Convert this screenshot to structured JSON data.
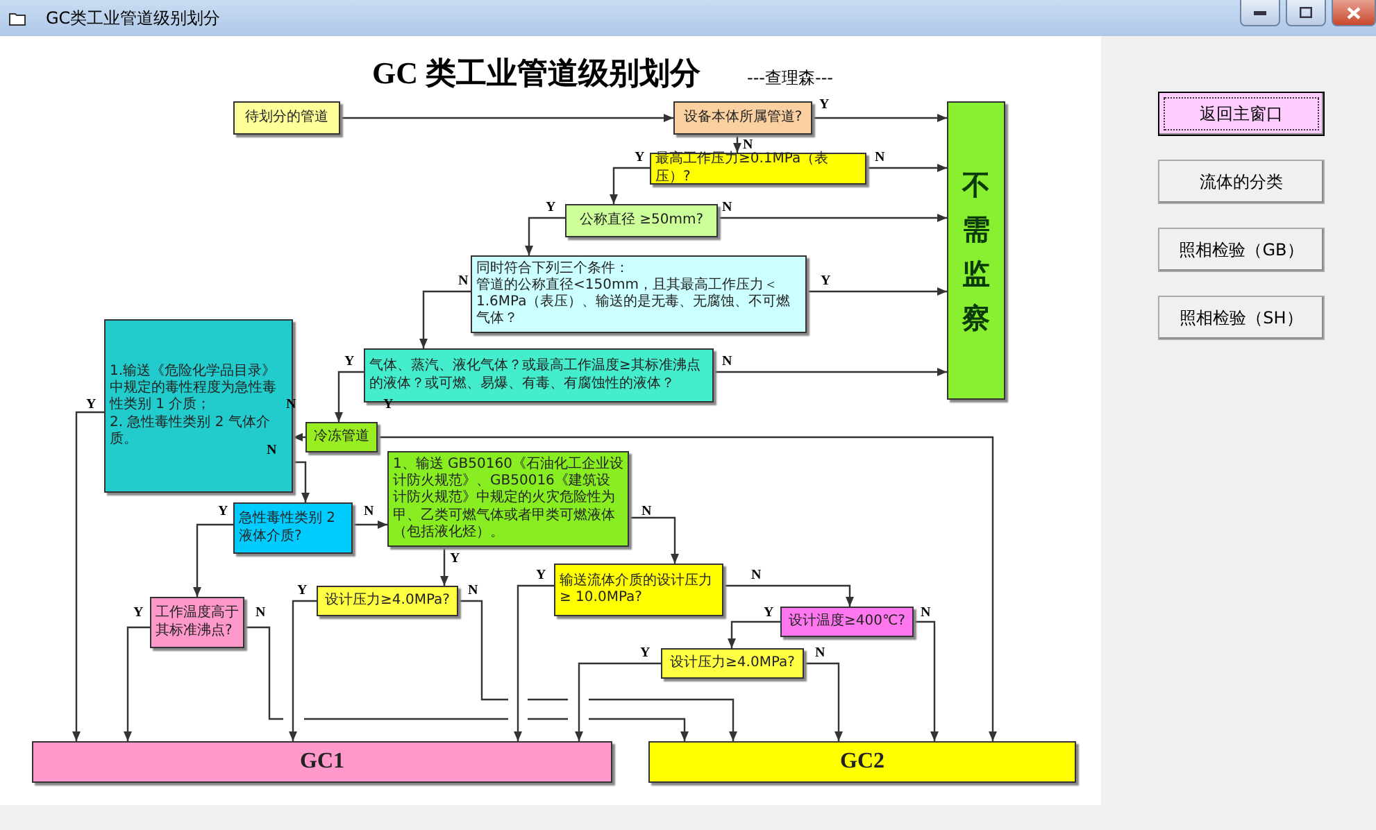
{
  "window": {
    "title": "GC类工业管道级别划分"
  },
  "chart_title": "GC 类工业管道级别划分",
  "author": "---查理森---",
  "nodes": [
    {
      "kind": "box",
      "lines": [
        "待划分的管道"
      ],
      "color": "#ffff99"
    },
    {
      "kind": "box",
      "lines": [
        "设备本体所属管道?"
      ],
      "color": "#fbd0a0"
    },
    {
      "kind": "vertical",
      "lines": [
        "不需监察"
      ],
      "color": "#88f030"
    },
    {
      "kind": "box",
      "lines": [
        "最高工作压力≥0.1MPa（表压）?"
      ],
      "color": "#ffff00"
    },
    {
      "kind": "box",
      "lines": [
        "公称直径 ≥50mm?"
      ],
      "color": "#ccff99"
    },
    {
      "kind": "box",
      "lines": [
        "同时符合下列三个条件：",
        "管道的公称直径<150mm，且其最高工作压力＜1.6MPa（表压）、输送的是无毒、无腐蚀、不可燃气体？"
      ],
      "color": "#ccffff"
    },
    {
      "kind": "box",
      "lines": [
        "气体、蒸汽、液化气体？或最高工作温度≥其标准沸点的液体？或可燃、易爆、有毒、有腐蚀性的液体？"
      ],
      "color": "#44eecc"
    },
    {
      "kind": "box",
      "lines": [
        "冷冻管道"
      ],
      "color": "#99ee22"
    },
    {
      "kind": "box",
      "lines": [
        "1.输送《危险化学品目录》中规定的毒性程度为急性毒性类别 1 介质；",
        "2. 急性毒性类别 2 气体介质。"
      ],
      "color": "#22cccc"
    },
    {
      "kind": "box",
      "lines": [
        "急性毒性类别 2 液体介质?"
      ],
      "color": "#00ccff"
    },
    {
      "kind": "box",
      "lines": [
        "1、输送 GB50160《石油化工企业设计防火规范》、GB50016《建筑设计防火规范》中规定的火灾危险性为甲、乙类可燃气体或者甲类可燃液体（包括液化烃）。"
      ],
      "color": "#88ee22"
    },
    {
      "kind": "box",
      "lines": [
        "工作温度高于其标准沸点?"
      ],
      "color": "#ff99cc"
    },
    {
      "kind": "box",
      "lines": [
        "设计压力≥4.0MPa?"
      ],
      "color": "#ffff44"
    },
    {
      "kind": "box",
      "lines": [
        "输送流体介质的设计压力 ≥ 10.0MPa?"
      ],
      "color": "#ffff00"
    },
    {
      "kind": "box",
      "lines": [
        "设计温度≥400℃?"
      ],
      "color": "#ff77ee"
    },
    {
      "kind": "box",
      "lines": [
        "设计压力≥4.0MPa?"
      ],
      "color": "#ffff44"
    },
    {
      "kind": "result",
      "lines": [
        "GC1"
      ],
      "color": "#ff99cc"
    },
    {
      "kind": "result",
      "lines": [
        "GC2"
      ],
      "color": "#ffff00"
    }
  ],
  "branch_labels": [
    "Y",
    "N",
    "Y",
    "N",
    "Y",
    "N",
    "N",
    "Y",
    "Y",
    "N",
    "Y",
    "N",
    "Y",
    "N",
    "Y",
    "N",
    "N",
    "Y",
    "Y",
    "N",
    "Y",
    "N",
    "Y",
    "N",
    "Y",
    "N",
    "Y",
    "N"
  ],
  "buttons": [
    {
      "label": "返回主窗口",
      "selected": true
    },
    {
      "label": "流体的分类",
      "selected": false
    },
    {
      "label": "照相检验（GB）",
      "selected": false
    },
    {
      "label": "照相检验（SH）",
      "selected": false
    }
  ]
}
